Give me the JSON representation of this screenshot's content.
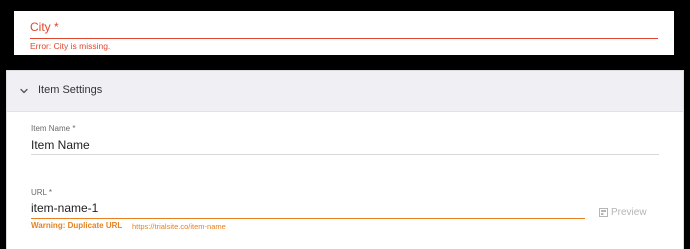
{
  "city_field": {
    "label": "City *",
    "error": "Error: City is missing."
  },
  "panel": {
    "title": "Item Settings",
    "item_name": {
      "label": "Item Name *",
      "value": "Item Name"
    },
    "url": {
      "label": "URL *",
      "value": "item-name-1",
      "warning": "Warning: Duplicate URL",
      "hint": "https://trialsite.co/item-name"
    },
    "preview_label": "Preview"
  },
  "icons": {
    "collapse": "chevron-down-icon",
    "preview": "preview-icon"
  },
  "colors": {
    "error": "#e0462e",
    "warning": "#e8801f",
    "header_bg": "#f0f0f4"
  }
}
